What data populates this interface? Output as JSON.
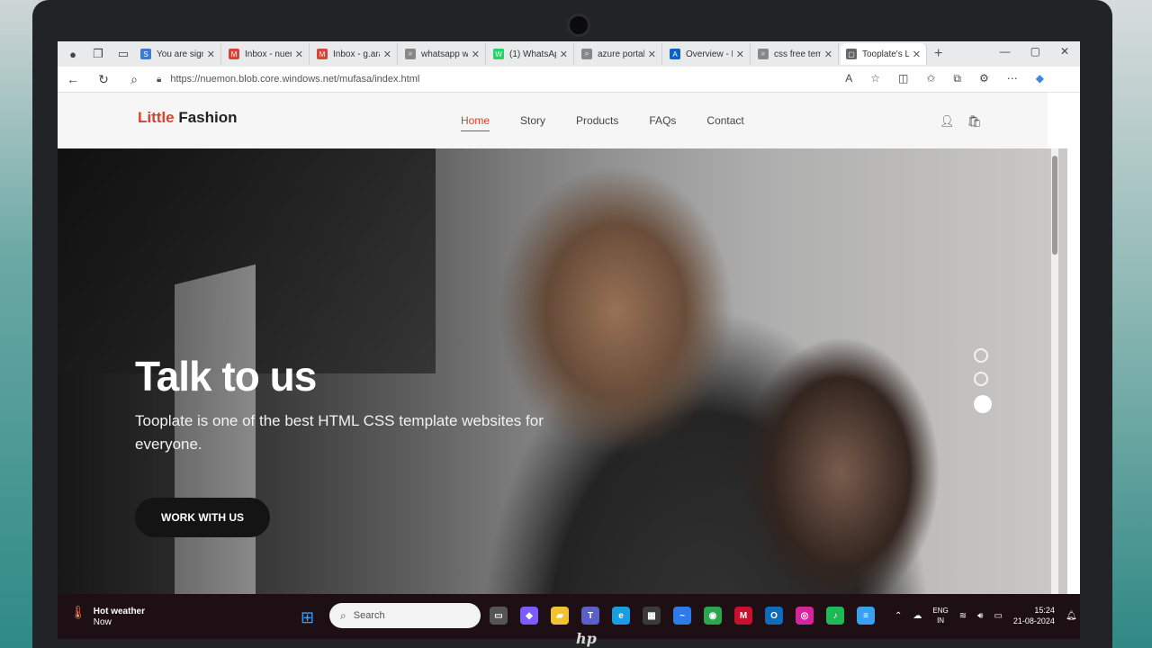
{
  "browser": {
    "tabs": [
      {
        "label": "You are signe",
        "color": "#3b7bd3",
        "glyph": "S"
      },
      {
        "label": "Inbox - nuem",
        "color": "#d44638",
        "glyph": "M"
      },
      {
        "label": "Inbox - g.ara",
        "color": "#d44638",
        "glyph": "M"
      },
      {
        "label": "whatsapp we",
        "color": "#888888",
        "glyph": "Q"
      },
      {
        "label": "(1) WhatsAp",
        "color": "#25d366",
        "glyph": "W"
      },
      {
        "label": "azure portal",
        "color": "#888888",
        "glyph": "Q"
      },
      {
        "label": "Overview - M",
        "color": "#0a64c8",
        "glyph": "A"
      },
      {
        "label": "css free temp",
        "color": "#888888",
        "glyph": "Q"
      },
      {
        "label": "Tooplate's Li",
        "color": "#666666",
        "glyph": "▢"
      }
    ],
    "url": "https://nuemon.blob.core.windows.net/mufasa/index.html"
  },
  "site": {
    "logo_part1": "Little",
    "logo_part2": "Fashion",
    "menu": [
      "Home",
      "Story",
      "Products",
      "FAQs",
      "Contact"
    ],
    "hero": {
      "title": "Talk to us",
      "subtitle": "Tooplate is one of the best HTML CSS template websites for everyone.",
      "button": "WORK WITH US"
    }
  },
  "taskbar": {
    "weather_title": "Hot weather",
    "weather_sub": "Now",
    "search_placeholder": "Search",
    "lang_top": "ENG",
    "lang_bottom": "IN",
    "time": "15:24",
    "date": "21-08-2024"
  },
  "colors": {
    "accent": "#d4432f",
    "button_bg": "#141414"
  }
}
